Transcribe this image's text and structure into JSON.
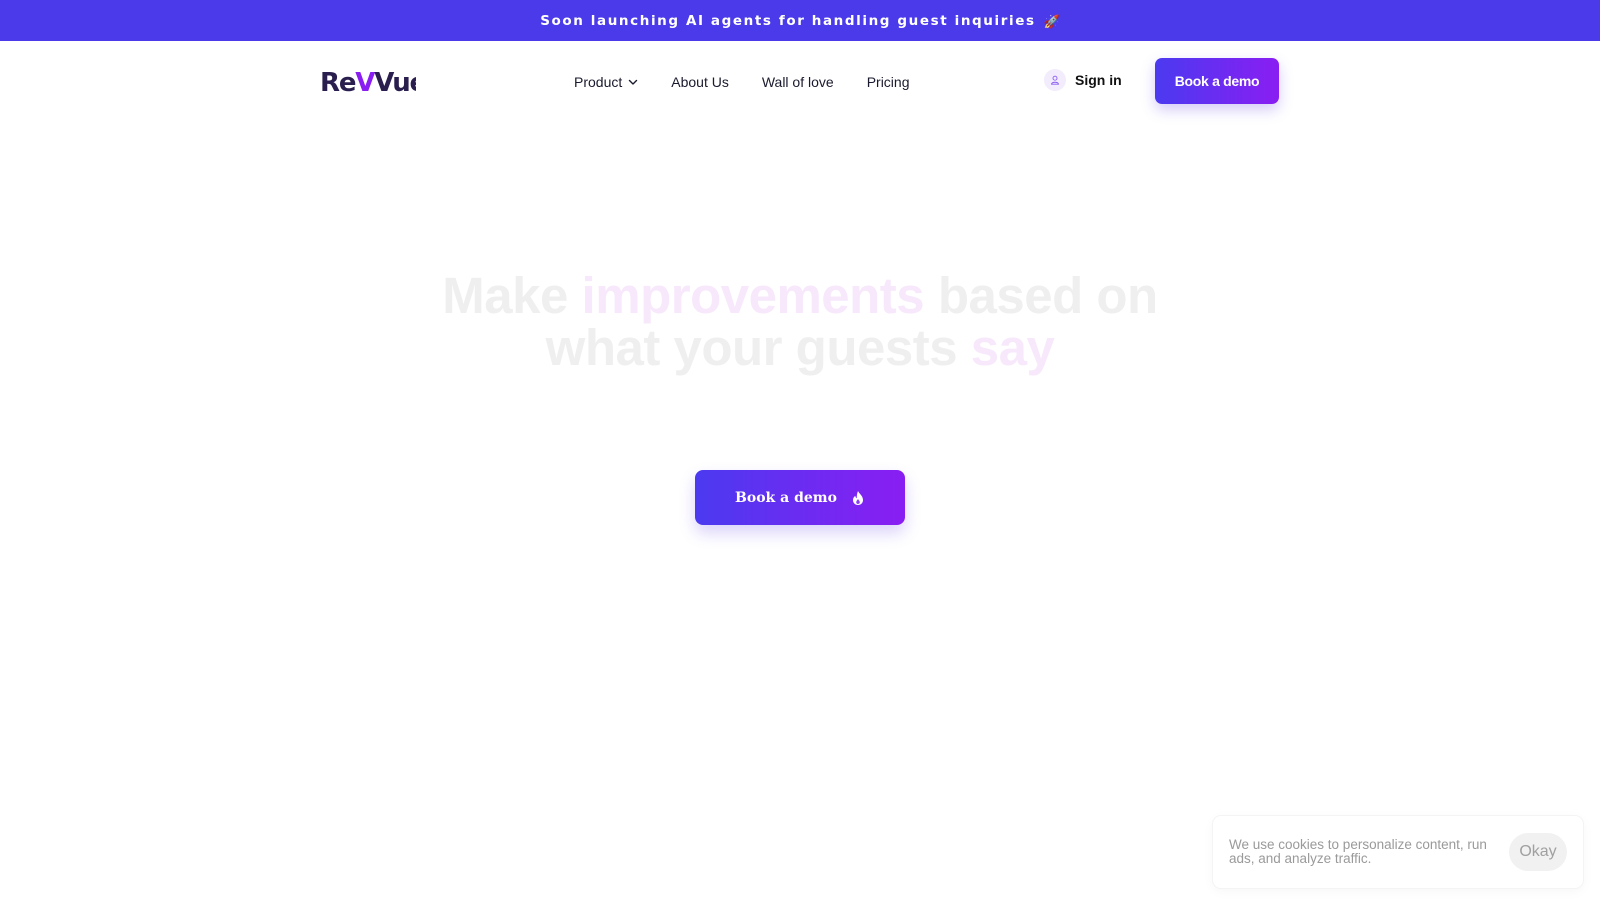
{
  "announcement": {
    "text": "Soon launching AI agents for handling guest inquiries",
    "icon": "rocket-icon"
  },
  "brand": {
    "logo_text": "RevVue",
    "primary_color": "#4a3aea",
    "gradient_start": "#4b3af0",
    "gradient_end": "#8a1ef2",
    "logo_dark": "#2a1e4e",
    "logo_accent": "#8a1ef2"
  },
  "nav": {
    "items": [
      {
        "label": "Product",
        "has_dropdown": true
      },
      {
        "label": "About Us"
      },
      {
        "label": "Wall of love"
      },
      {
        "label": "Pricing"
      }
    ],
    "signin_label": "Sign in",
    "cta_label": "Book a demo"
  },
  "hero": {
    "line1": {
      "pre": "Make ",
      "accent": "improvements",
      "post": " based on"
    },
    "line2": {
      "pre": "what your guests ",
      "accent": "say"
    },
    "cta_label": "Book a demo",
    "cta_icon": "fire-icon"
  },
  "cookie": {
    "text": "We use cookies to personalize content, run ads, and analyze traffic.",
    "button_label": "Okay"
  }
}
